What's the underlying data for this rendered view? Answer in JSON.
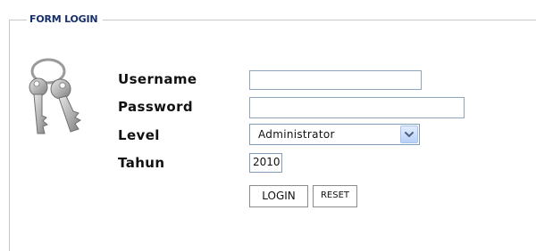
{
  "form": {
    "legend": "FORM LOGIN",
    "username": {
      "label": "Username",
      "value": ""
    },
    "password": {
      "label": "Password",
      "value": ""
    },
    "level": {
      "label": "Level",
      "selected": "Administrator"
    },
    "year": {
      "label": "Tahun",
      "value": "2010"
    },
    "login_label": "LOGIN",
    "reset_label": "RESET"
  },
  "icons": {
    "keys": "keys-icon",
    "dropdown": "chevron-down-icon"
  },
  "colors": {
    "legend_text": "#16306b",
    "border": "#c8c8c8",
    "input_border": "#7f9db9",
    "select_button": "#b9d0f7"
  }
}
